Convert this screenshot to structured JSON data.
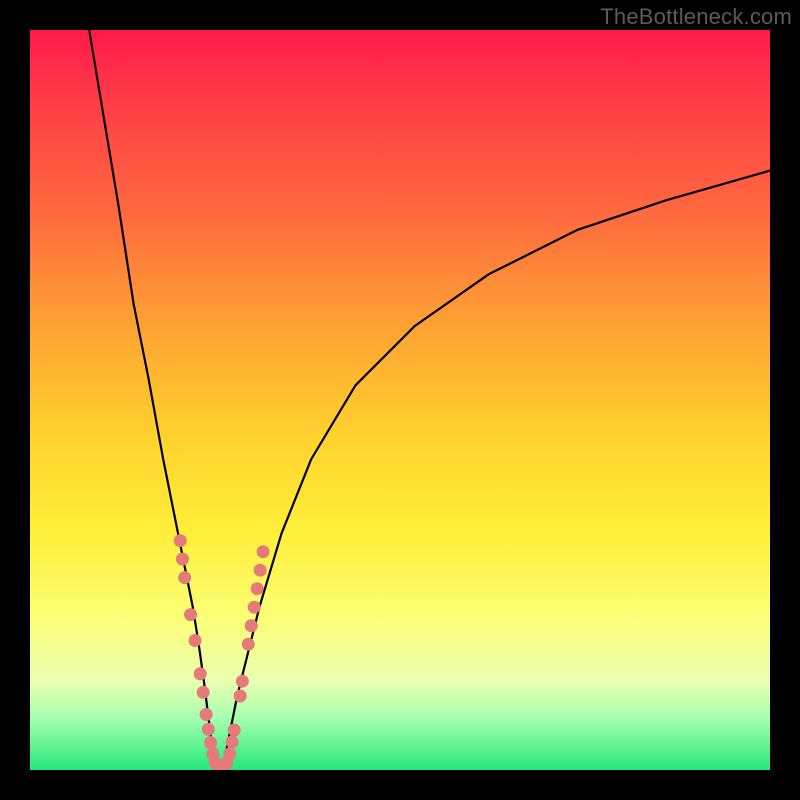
{
  "watermark": "TheBottleneck.com",
  "chart_data": {
    "type": "line",
    "title": "",
    "xlabel": "",
    "ylabel": "",
    "xlim": [
      0,
      100
    ],
    "ylim": [
      0,
      100
    ],
    "series": [
      {
        "name": "left-curve",
        "x": [
          8,
          10,
          12,
          14,
          16,
          18,
          20,
          21,
          22,
          22.8,
          23.5,
          24,
          24.5,
          25
        ],
        "values": [
          100,
          88,
          76,
          63,
          53,
          42,
          32,
          27,
          22,
          17,
          12,
          8,
          4,
          0
        ]
      },
      {
        "name": "right-curve",
        "x": [
          26,
          27,
          28,
          29,
          31,
          34,
          38,
          44,
          52,
          62,
          74,
          86,
          100
        ],
        "values": [
          0,
          5,
          10,
          14,
          22,
          32,
          42,
          52,
          60,
          67,
          73,
          77,
          81
        ]
      }
    ],
    "markers": {
      "name": "highlight-points",
      "color": "#e47a7a",
      "points_xy": [
        [
          20.3,
          31
        ],
        [
          20.6,
          28.5
        ],
        [
          20.9,
          26
        ],
        [
          21.7,
          21
        ],
        [
          22.3,
          17.5
        ],
        [
          23.0,
          13
        ],
        [
          23.4,
          10.5
        ],
        [
          23.8,
          7.5
        ],
        [
          24.1,
          5.5
        ],
        [
          24.4,
          3.7
        ],
        [
          24.7,
          2.2
        ],
        [
          25.0,
          1.0
        ],
        [
          25.4,
          0.4
        ],
        [
          25.8,
          0.2
        ],
        [
          26.2,
          0.4
        ],
        [
          26.6,
          1.0
        ],
        [
          27.0,
          2.2
        ],
        [
          27.3,
          3.8
        ],
        [
          27.6,
          5.4
        ],
        [
          28.4,
          10.0
        ],
        [
          28.7,
          12.0
        ],
        [
          29.5,
          17.0
        ],
        [
          29.9,
          19.5
        ],
        [
          30.3,
          22.0
        ],
        [
          30.7,
          24.5
        ],
        [
          31.1,
          27.0
        ],
        [
          31.5,
          29.5
        ]
      ]
    },
    "colors": {
      "background_gradient_top": "#ff1a4b",
      "background_gradient_bottom": "#24e87a",
      "curve": "#000000",
      "marker": "#e47a7a",
      "frame": "#000000"
    }
  }
}
